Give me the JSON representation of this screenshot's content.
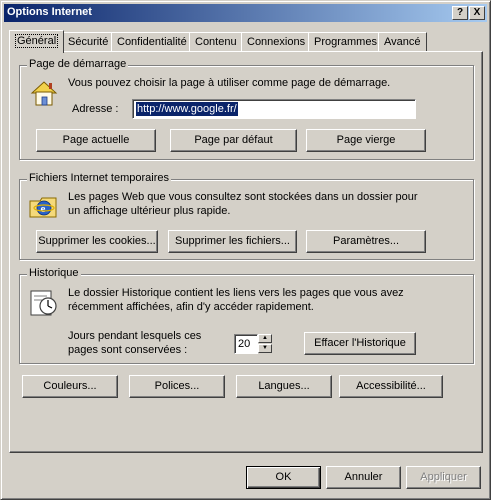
{
  "window": {
    "title": "Options Internet",
    "help_button": "?",
    "close_button": "X"
  },
  "tabs": [
    {
      "label": "Général",
      "active": true
    },
    {
      "label": "Sécurité"
    },
    {
      "label": "Confidentialité"
    },
    {
      "label": "Contenu"
    },
    {
      "label": "Connexions"
    },
    {
      "label": "Programmes"
    },
    {
      "label": "Avancé"
    }
  ],
  "homepage": {
    "title": "Page de démarrage",
    "icon": "home-icon",
    "description": "Vous pouvez choisir la page à utiliser comme page de démarrage.",
    "address_label": "Adresse :",
    "address_value": "http://www.google.fr/",
    "buttons": {
      "current": "Page actuelle",
      "default": "Page par défaut",
      "blank": "Page vierge"
    }
  },
  "temp_files": {
    "title": "Fichiers Internet temporaires",
    "icon": "ie-folder-icon",
    "description_line1": "Les pages Web que vous consultez sont stockées dans un dossier pour",
    "description_line2": "un affichage ultérieur plus rapide.",
    "buttons": {
      "delete_cookies": "Supprimer les cookies...",
      "delete_files": "Supprimer les fichiers...",
      "settings": "Paramètres..."
    }
  },
  "history": {
    "title": "Historique",
    "icon": "history-clock-icon",
    "description_line1": "Le dossier Historique contient les liens vers les pages que vous avez",
    "description_line2": "récemment affichées, afin d'y accéder rapidement.",
    "days_label_line1": "Jours pendant lesquels ces",
    "days_label_line2": "pages sont conservées :",
    "days_value": "20",
    "clear_button": "Effacer l'Historique"
  },
  "bottom_buttons": {
    "colors": "Couleurs...",
    "fonts": "Polices...",
    "languages": "Langues...",
    "accessibility": "Accessibilité..."
  },
  "dialog_buttons": {
    "ok": "OK",
    "cancel": "Annuler",
    "apply": "Appliquer"
  }
}
